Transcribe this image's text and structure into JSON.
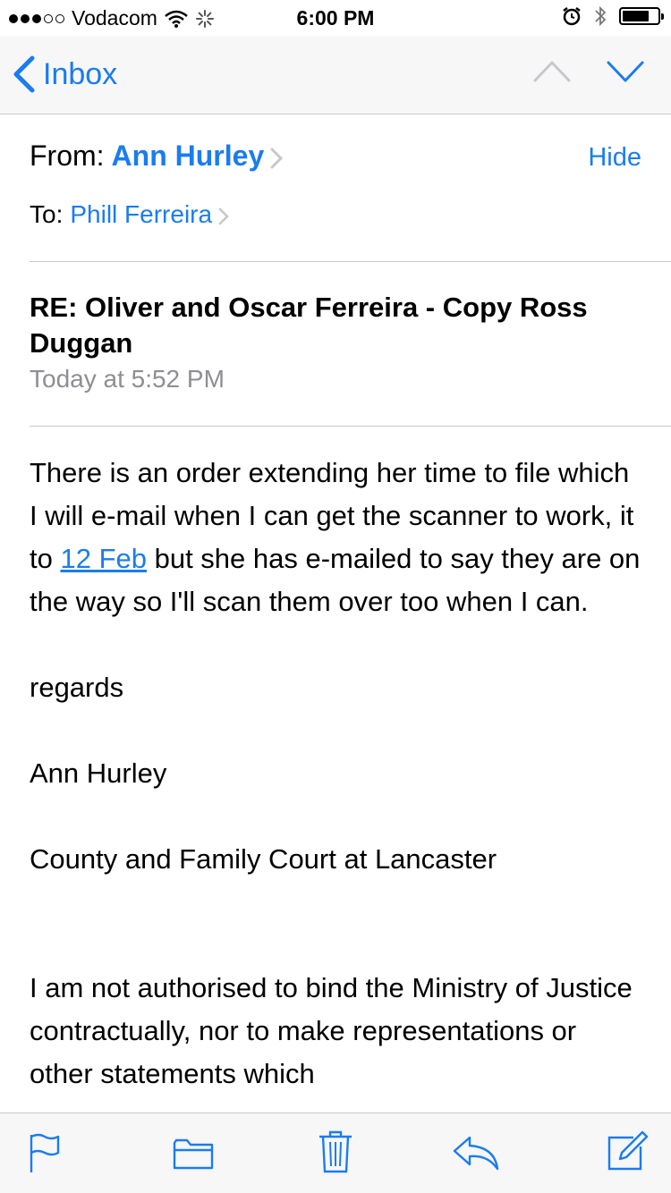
{
  "status_bar": {
    "carrier": "Vodacom",
    "time": "6:00 PM",
    "signal_icon": "signal-dots-icon",
    "wifi_icon": "wifi-icon",
    "activity_icon": "activity-spinner-icon",
    "alarm_icon": "alarm-icon",
    "bluetooth_icon": "bluetooth-icon",
    "battery_icon": "battery-icon"
  },
  "nav": {
    "back_label": "Inbox",
    "prev_icon": "chevron-up-icon",
    "next_icon": "chevron-down-icon"
  },
  "header": {
    "from_label": "From:",
    "from_name": "Ann Hurley",
    "hide_label": "Hide",
    "to_label": "To:",
    "to_name": "Phill Ferreira",
    "subject": "RE: Oliver and Oscar Ferreira - Copy Ross Duggan",
    "date": "Today at 5:52 PM"
  },
  "body": {
    "para1_before": "There is an order extending her time to file which I will e-mail when I can get the scanner to work, it to ",
    "para1_link": "12 Feb",
    "para1_after": " but she has e-mailed to say they are on the way so I'll scan them over too when I can.",
    "regards": "regards",
    "signature_name": "Ann Hurley",
    "signature_org": "County and Family Court at Lancaster",
    "disclaimer": "I am not authorised to bind the Ministry of Justice contractually, nor to make representations or other statements which"
  },
  "toolbar": {
    "flag_icon": "flag-icon",
    "folder_icon": "folder-icon",
    "trash_icon": "trash-icon",
    "reply_icon": "reply-icon",
    "compose_icon": "compose-icon"
  },
  "colors": {
    "accent": "#1a7cf0",
    "secondary_text": "#8e8e93",
    "separator": "#c8c7cc",
    "bar_background": "#f7f7f7"
  }
}
